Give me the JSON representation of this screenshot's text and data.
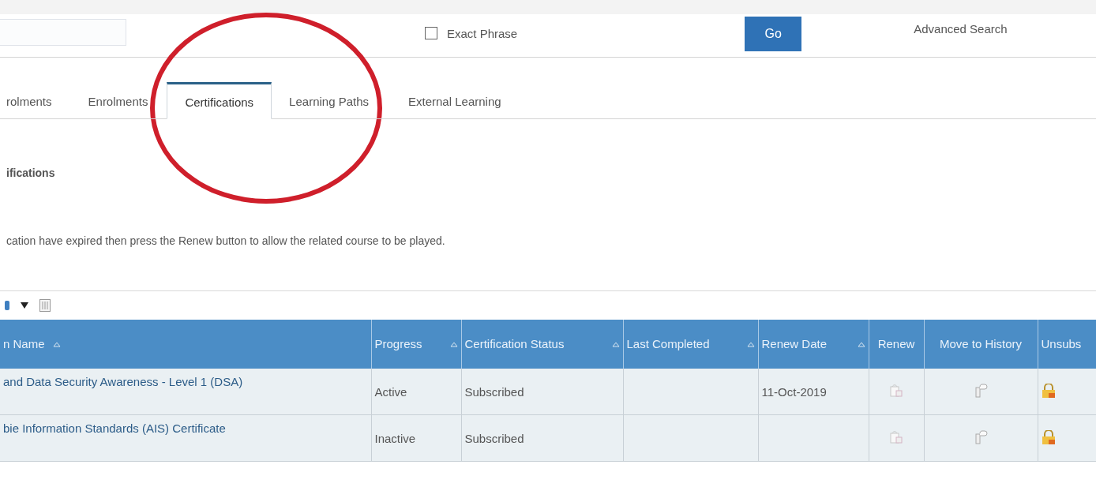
{
  "search_bar": {
    "exact_phrase": {
      "label": "Exact Phrase",
      "checked": false
    },
    "go_button": "Go",
    "advanced_search": "Advanced Search"
  },
  "tabs": [
    {
      "label": "rolments",
      "selected": false
    },
    {
      "label": "Enrolments",
      "selected": false
    },
    {
      "label": "Certifications",
      "selected": true
    },
    {
      "label": "Learning Paths",
      "selected": false
    },
    {
      "label": "External Learning",
      "selected": false
    }
  ],
  "section_title": "ifications",
  "instructions": "cation have expired then press the Renew button to allow the related course to be played.",
  "table": {
    "columns": [
      {
        "label": "n Name",
        "sortable": true
      },
      {
        "label": "Progress",
        "sortable": true
      },
      {
        "label": "Certification Status",
        "sortable": true
      },
      {
        "label": "Last Completed",
        "sortable": true
      },
      {
        "label": "Renew Date",
        "sortable": true
      },
      {
        "label": "Renew",
        "sortable": false
      },
      {
        "label": "Move to History",
        "sortable": false
      },
      {
        "label": "Unsubs",
        "sortable": false
      }
    ],
    "rows": [
      {
        "name": "and Data Security Awareness - Level 1 (DSA)",
        "progress": "Active",
        "status": "Subscribed",
        "last_completed": null,
        "renew_date": "11-Oct-2019"
      },
      {
        "name": "bie Information Standards (AIS) Certificate",
        "progress": "Inactive",
        "status": "Subscribed",
        "last_completed": null,
        "renew_date": null
      }
    ]
  },
  "annotation": {
    "kind": "circle",
    "color": "#cf1f2b"
  }
}
